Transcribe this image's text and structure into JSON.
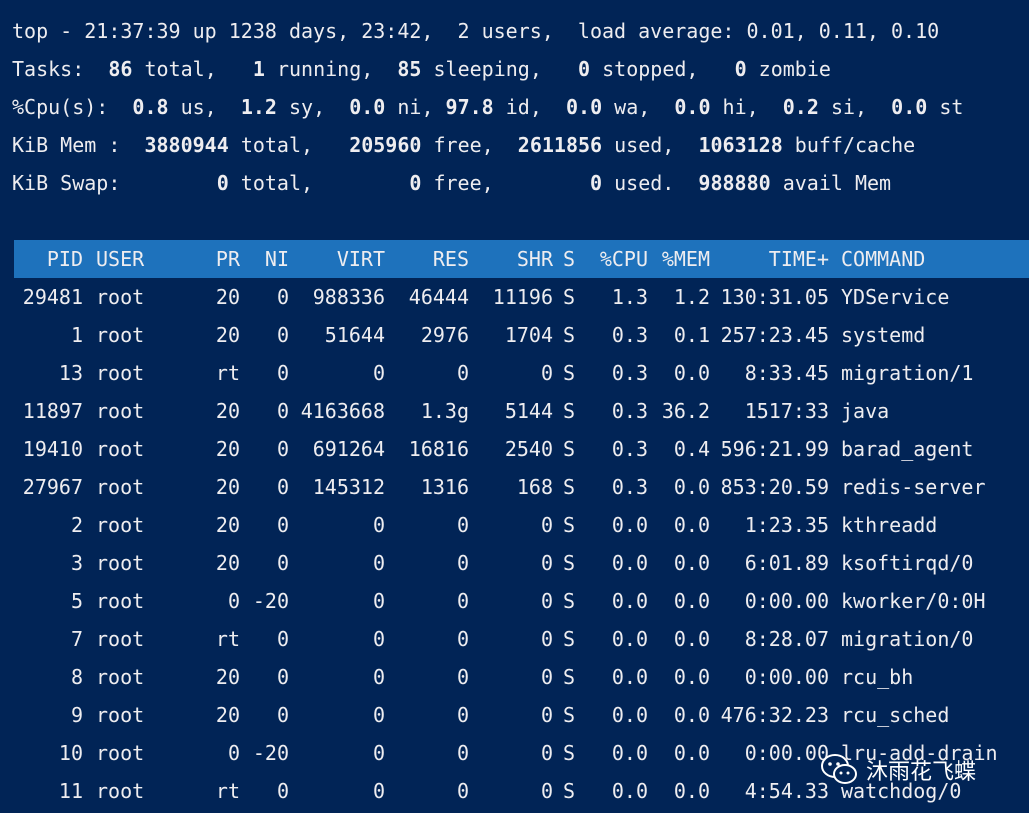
{
  "summary": {
    "top_line": "top - 21:37:39 up 1238 days, 23:42,  2 users,  load average: 0.01, 0.11, 0.10",
    "tasks": {
      "label": "Tasks:",
      "total": "86",
      "total_label": "total,",
      "running": "1",
      "running_label": "running,",
      "sleeping": "85",
      "sleeping_label": "sleeping,",
      "stopped": "0",
      "stopped_label": "stopped,",
      "zombie": "0",
      "zombie_label": "zombie"
    },
    "cpu": {
      "label": "%Cpu(s):",
      "us": "0.8",
      "us_label": "us,",
      "sy": "1.2",
      "sy_label": "sy,",
      "ni": "0.0",
      "ni_label": "ni,",
      "id": "97.8",
      "id_label": "id,",
      "wa": "0.0",
      "wa_label": "wa,",
      "hi": "0.0",
      "hi_label": "hi,",
      "si": "0.2",
      "si_label": "si,",
      "st": "0.0",
      "st_label": "st"
    },
    "mem": {
      "label": "KiB Mem :",
      "total": "3880944",
      "total_label": "total,",
      "free": "205960",
      "free_label": "free,",
      "used": "2611856",
      "used_label": "used,",
      "buff": "1063128",
      "buff_label": "buff/cache"
    },
    "swap": {
      "label": "KiB Swap:",
      "total": "0",
      "total_label": "total,",
      "free": "0",
      "free_label": "free,",
      "used": "0",
      "used_label": "used.",
      "avail": "988880",
      "avail_label": "avail Mem"
    }
  },
  "table": {
    "headers": {
      "pid": "PID",
      "user": "USER",
      "pr": "PR",
      "ni": "NI",
      "virt": "VIRT",
      "res": "RES",
      "shr": "SHR",
      "s": "S",
      "cpu": "%CPU",
      "mem": "%MEM",
      "time": "TIME+",
      "cmd": "COMMAND"
    },
    "rows": [
      {
        "pid": "29481",
        "user": "root",
        "pr": "20",
        "ni": "0",
        "virt": "988336",
        "res": "46444",
        "shr": "11196",
        "s": "S",
        "cpu": "1.3",
        "mem": "1.2",
        "time": "130:31.05",
        "cmd": "YDService"
      },
      {
        "pid": "1",
        "user": "root",
        "pr": "20",
        "ni": "0",
        "virt": "51644",
        "res": "2976",
        "shr": "1704",
        "s": "S",
        "cpu": "0.3",
        "mem": "0.1",
        "time": "257:23.45",
        "cmd": "systemd"
      },
      {
        "pid": "13",
        "user": "root",
        "pr": "rt",
        "ni": "0",
        "virt": "0",
        "res": "0",
        "shr": "0",
        "s": "S",
        "cpu": "0.3",
        "mem": "0.0",
        "time": "8:33.45",
        "cmd": "migration/1"
      },
      {
        "pid": "11897",
        "user": "root",
        "pr": "20",
        "ni": "0",
        "virt": "4163668",
        "res": "1.3g",
        "shr": "5144",
        "s": "S",
        "cpu": "0.3",
        "mem": "36.2",
        "time": "1517:33",
        "cmd": "java"
      },
      {
        "pid": "19410",
        "user": "root",
        "pr": "20",
        "ni": "0",
        "virt": "691264",
        "res": "16816",
        "shr": "2540",
        "s": "S",
        "cpu": "0.3",
        "mem": "0.4",
        "time": "596:21.99",
        "cmd": "barad_agent"
      },
      {
        "pid": "27967",
        "user": "root",
        "pr": "20",
        "ni": "0",
        "virt": "145312",
        "res": "1316",
        "shr": "168",
        "s": "S",
        "cpu": "0.3",
        "mem": "0.0",
        "time": "853:20.59",
        "cmd": "redis-server"
      },
      {
        "pid": "2",
        "user": "root",
        "pr": "20",
        "ni": "0",
        "virt": "0",
        "res": "0",
        "shr": "0",
        "s": "S",
        "cpu": "0.0",
        "mem": "0.0",
        "time": "1:23.35",
        "cmd": "kthreadd"
      },
      {
        "pid": "3",
        "user": "root",
        "pr": "20",
        "ni": "0",
        "virt": "0",
        "res": "0",
        "shr": "0",
        "s": "S",
        "cpu": "0.0",
        "mem": "0.0",
        "time": "6:01.89",
        "cmd": "ksoftirqd/0"
      },
      {
        "pid": "5",
        "user": "root",
        "pr": "0",
        "ni": "-20",
        "virt": "0",
        "res": "0",
        "shr": "0",
        "s": "S",
        "cpu": "0.0",
        "mem": "0.0",
        "time": "0:00.00",
        "cmd": "kworker/0:0H"
      },
      {
        "pid": "7",
        "user": "root",
        "pr": "rt",
        "ni": "0",
        "virt": "0",
        "res": "0",
        "shr": "0",
        "s": "S",
        "cpu": "0.0",
        "mem": "0.0",
        "time": "8:28.07",
        "cmd": "migration/0"
      },
      {
        "pid": "8",
        "user": "root",
        "pr": "20",
        "ni": "0",
        "virt": "0",
        "res": "0",
        "shr": "0",
        "s": "S",
        "cpu": "0.0",
        "mem": "0.0",
        "time": "0:00.00",
        "cmd": "rcu_bh"
      },
      {
        "pid": "9",
        "user": "root",
        "pr": "20",
        "ni": "0",
        "virt": "0",
        "res": "0",
        "shr": "0",
        "s": "S",
        "cpu": "0.0",
        "mem": "0.0",
        "time": "476:32.23",
        "cmd": "rcu_sched"
      },
      {
        "pid": "10",
        "user": "root",
        "pr": "0",
        "ni": "-20",
        "virt": "0",
        "res": "0",
        "shr": "0",
        "s": "S",
        "cpu": "0.0",
        "mem": "0.0",
        "time": "0:00.00",
        "cmd": "lru-add-drain"
      },
      {
        "pid": "11",
        "user": "root",
        "pr": "rt",
        "ni": "0",
        "virt": "0",
        "res": "0",
        "shr": "0",
        "s": "S",
        "cpu": "0.0",
        "mem": "0.0",
        "time": "4:54.33",
        "cmd": "watchdog/0"
      }
    ]
  },
  "watermark": {
    "text": "沐雨花飞蝶",
    "icon": "wechat-icon"
  },
  "colors": {
    "background": "#012456",
    "foreground": "#eeedf0",
    "header_bg": "#1e72bc"
  }
}
